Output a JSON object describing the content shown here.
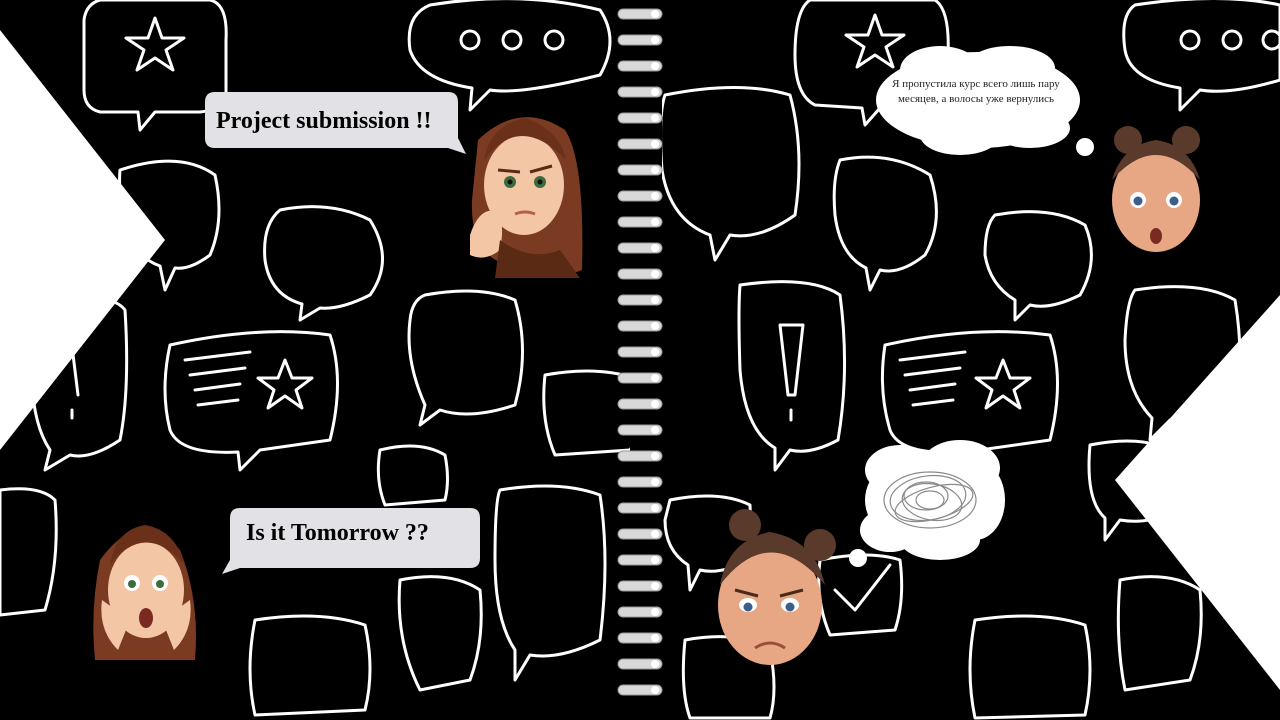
{
  "scene": {
    "background_color": "#000000",
    "doodle_color": "#ffffff",
    "accent_white": "#ffffff",
    "bubble_gray": "#e2e2e6"
  },
  "dialogue": {
    "left_top": {
      "text": "Project submission !!",
      "speaker_icon": "thinking-woman-icon"
    },
    "left_bottom": {
      "text": "Is it Tomorrow ??",
      "speaker_icon": "shocked-woman-icon"
    },
    "right_top": {
      "text": "Я пропустила курс всего лишь пару месяцев, а волосы уже вернулись",
      "speaker_icon": "surprised-girl-icon"
    },
    "right_bottom": {
      "speaker_icon": "sad-girl-icon",
      "thought_icon": "scribble-icon"
    }
  },
  "binding": {
    "icon": "spiral-binding-icon",
    "rings": 27
  }
}
